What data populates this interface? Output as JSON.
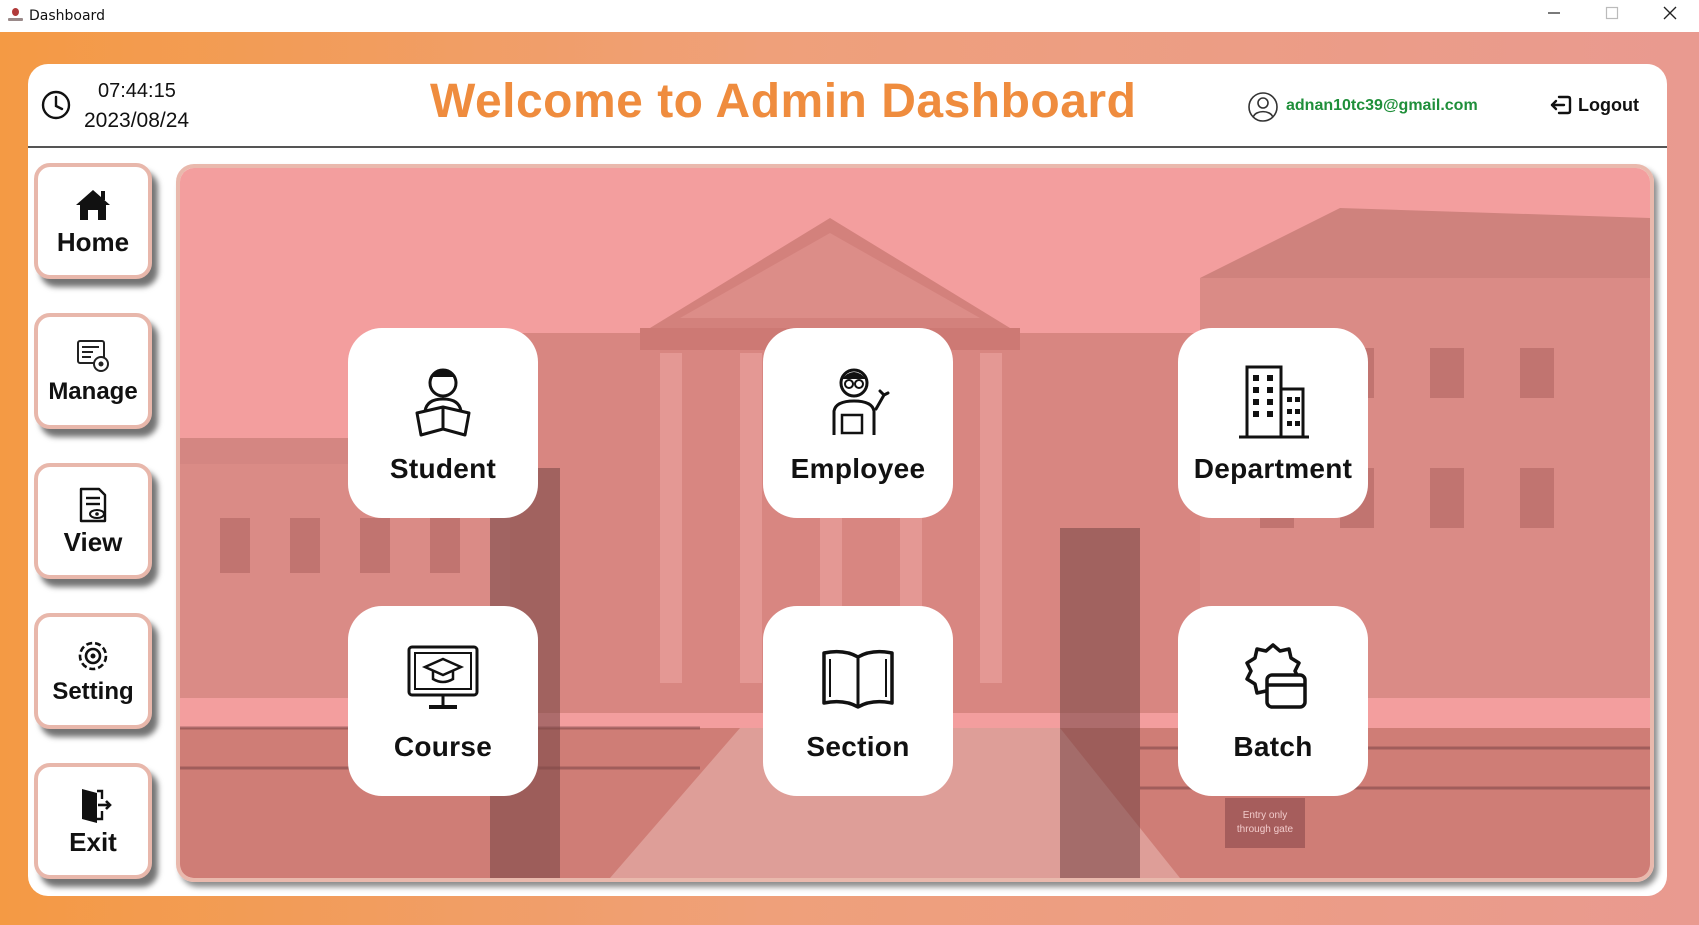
{
  "window": {
    "title": "Dashboard"
  },
  "header": {
    "time": "07:44:15",
    "date": "2023/08/24",
    "title": "Welcome to Admin Dashboard",
    "email": "adnan10tc39@gmail.com",
    "logout_label": "Logout"
  },
  "sidebar": {
    "items": [
      {
        "label": "Home",
        "icon": "home-icon"
      },
      {
        "label": "Manage",
        "icon": "manage-icon"
      },
      {
        "label": "View",
        "icon": "view-document-icon"
      },
      {
        "label": "Setting",
        "icon": "gear-icon"
      },
      {
        "label": "Exit",
        "icon": "exit-door-icon"
      }
    ]
  },
  "tiles": [
    {
      "label": "Student",
      "icon": "student-reading-icon"
    },
    {
      "label": "Employee",
      "icon": "employee-icon"
    },
    {
      "label": "Department",
      "icon": "building-icon"
    },
    {
      "label": "Course",
      "icon": "course-monitor-icon"
    },
    {
      "label": "Section",
      "icon": "open-book-icon"
    },
    {
      "label": "Batch",
      "icon": "badge-card-icon"
    }
  ],
  "background": {
    "sign_line1": "Entry only",
    "sign_line2": "through gate"
  },
  "colors": {
    "accent": "#ef8c3e",
    "email": "#1f8f3a",
    "overlay": "#e98a8a"
  }
}
